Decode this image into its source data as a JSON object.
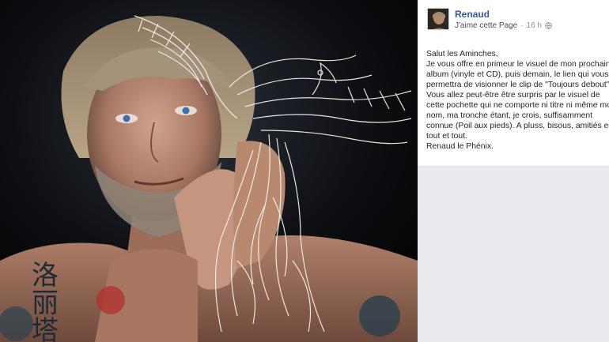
{
  "post": {
    "page_name": "Renaud",
    "like_page_label": "J'aime cette Page",
    "separator": "·",
    "timestamp": "16 h",
    "privacy_icon": "globe-icon",
    "lines": [
      "Salut les Aminches,",
      "Je vous offre en primeur le visuel de mon prochain",
      "album (vinyle et CD), puis demain, le lien qui vous",
      "permettra de visionner le clip de \"Toujours debout\".",
      "Vous allez peut-être être surpris par le visuel de",
      "cette pochette qui ne comporte ni titre ni même mon",
      "nom, ma tronche étant, je crois, suffisamment",
      "connue (Poil aux pieds). A pluss, bisous, amitiés et",
      "tout et tout.",
      "Renaud le Phénix."
    ]
  },
  "tattoo_glyphs": "洛丽塔",
  "colors": {
    "link": "#3b5998",
    "text": "#1d2129",
    "meta": "#90949c",
    "photo_bg": "#07080b"
  }
}
